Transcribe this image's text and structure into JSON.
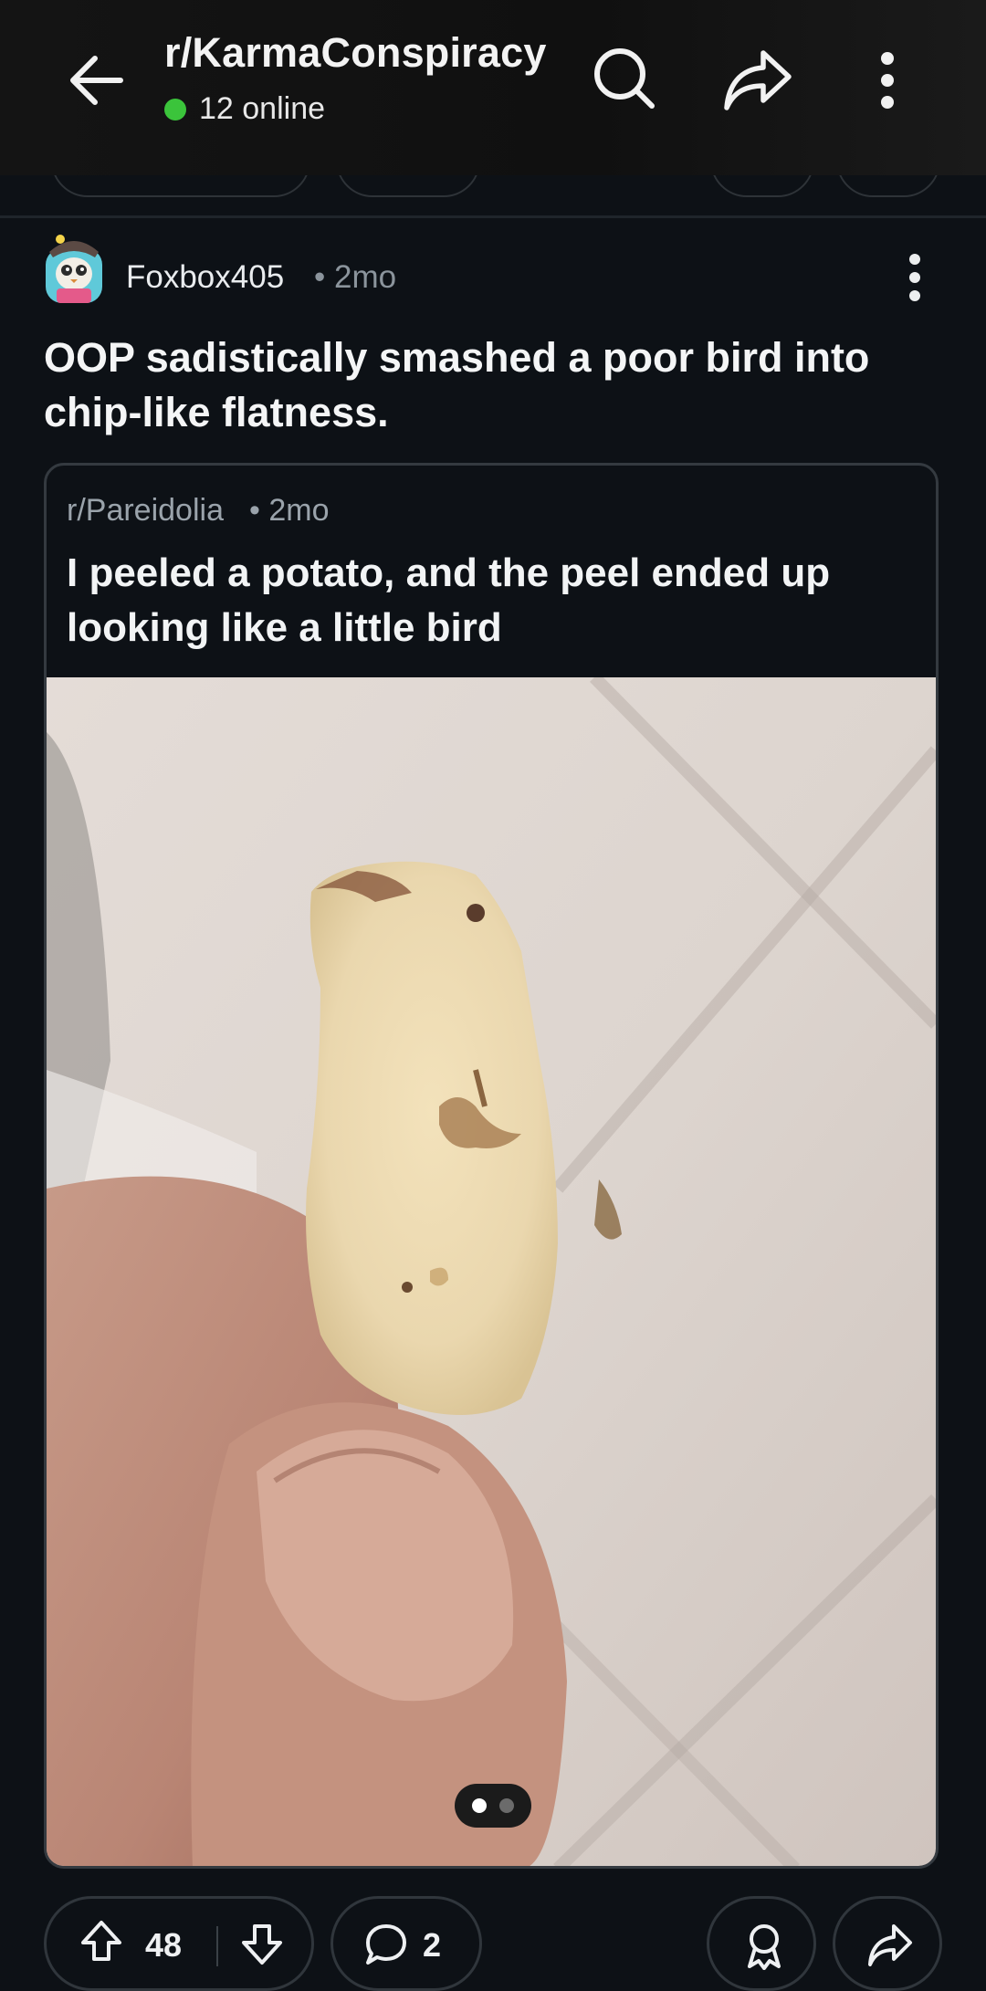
{
  "topbar": {
    "subreddit": "r/KarmaConspiracy",
    "online_count": "12 online",
    "icons": [
      "back-arrow-icon",
      "search-icon",
      "share-icon",
      "more-vertical-icon"
    ]
  },
  "post": {
    "author": "Foxbox405",
    "age": "• 2mo",
    "title": "OOP sadistically smashed a poor bird into chip-like flatness.",
    "crosspost": {
      "subreddit": "r/Pareidolia",
      "age": "• 2mo",
      "title": "I peeled a potato, and the peel ended up looking like a little bird",
      "gallery": {
        "current": 1,
        "total": 2
      }
    }
  },
  "actions": {
    "upvotes": "48",
    "comments": "2"
  },
  "colors": {
    "background": "#0d1116",
    "online": "#3bc43b",
    "border": "#343a40"
  }
}
